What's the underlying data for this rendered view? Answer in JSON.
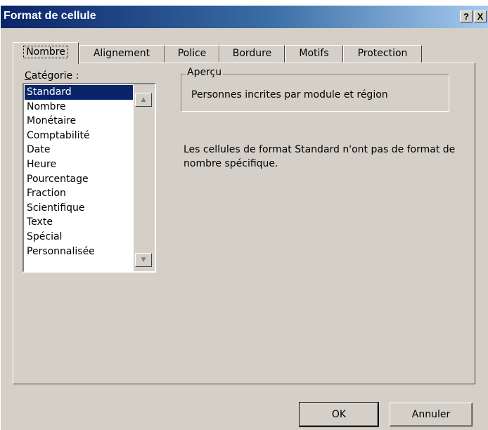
{
  "window": {
    "title": "Format de cellule",
    "help_button": "?",
    "close_button": "X"
  },
  "tabs": [
    {
      "label": "Nombre",
      "active": true
    },
    {
      "label": "Alignement"
    },
    {
      "label": "Police"
    },
    {
      "label": "Bordure"
    },
    {
      "label": "Motifs"
    },
    {
      "label": "Protection"
    }
  ],
  "category": {
    "label": "Catégorie :",
    "selected": "Standard",
    "items": [
      "Standard",
      "Nombre",
      "Monétaire",
      "Comptabilité",
      "Date",
      "Heure",
      "Pourcentage",
      "Fraction",
      "Scientifique",
      "Texte",
      "Spécial",
      "Personnalisée"
    ]
  },
  "preview": {
    "legend": "Aperçu",
    "value": "Personnes incrites par module et région"
  },
  "description": "Les cellules de format Standard n'ont pas de format de nombre spécifique.",
  "buttons": {
    "ok": "OK",
    "cancel": "Annuler"
  },
  "icons": {
    "scroll_up": "triangle-up",
    "scroll_down": "triangle-down"
  }
}
